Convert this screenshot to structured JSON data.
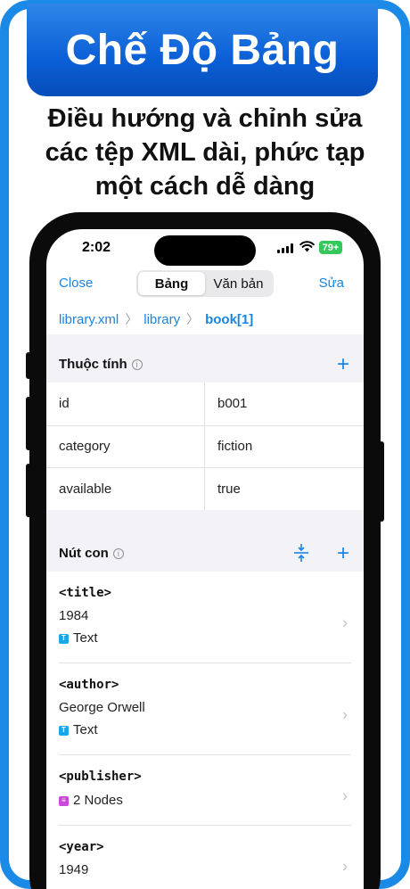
{
  "banner": {
    "title": "Chế Độ Bảng"
  },
  "subtitle": {
    "line1": "Điều hướng và chỉnh sửa",
    "line2": "các tệp XML dài, phức tạp",
    "line3": "một cách dễ dàng"
  },
  "status": {
    "time": "2:02",
    "battery": "79+"
  },
  "nav": {
    "close": "Close",
    "segments": [
      "Bảng",
      "Văn bản"
    ],
    "edit": "Sửa"
  },
  "breadcrumb": [
    "library.xml",
    "library",
    "book[1]"
  ],
  "attributes": {
    "title": "Thuộc tính",
    "rows": [
      {
        "key": "id",
        "value": "b001"
      },
      {
        "key": "category",
        "value": "fiction"
      },
      {
        "key": "available",
        "value": "true"
      }
    ]
  },
  "children": {
    "title": "Nút con",
    "nodes": [
      {
        "tag": "<title>",
        "value": "1984",
        "type": "Text"
      },
      {
        "tag": "<author>",
        "value": "George Orwell",
        "type": "Text"
      },
      {
        "tag": "<publisher>",
        "type": "2 Nodes"
      },
      {
        "tag": "<year>",
        "value": "1949"
      }
    ]
  },
  "colors": {
    "accent": "#1a84e0",
    "banner": "#0b5fd6",
    "frame": "#1b8ae6",
    "text_badge": "#1aa7e8",
    "nodes_badge": "#c94ad6"
  },
  "icons": [
    "info-icon",
    "plus-icon",
    "collapse-icon",
    "chevron-right-icon",
    "wifi-icon",
    "signal-icon",
    "battery-icon"
  ]
}
